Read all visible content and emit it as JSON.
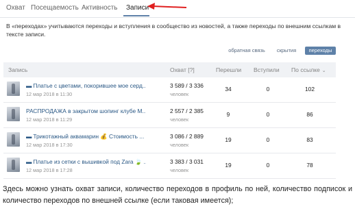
{
  "tabs": [
    {
      "label": "Охват"
    },
    {
      "label": "Посещаемость"
    },
    {
      "label": "Активность"
    },
    {
      "label": "Записи"
    }
  ],
  "info_text": "В «переходах» учитываются переходы и вступления в сообщество из новостей, а также переходы по внешним ссылкам в тексте записи.",
  "filters": [
    {
      "label": "обратная связь"
    },
    {
      "label": "скрытия"
    },
    {
      "label": "переходы"
    }
  ],
  "table": {
    "headers": {
      "post": "Запись",
      "reach": "Охват [?]",
      "clicks": "Перешли",
      "joined": "Вступили",
      "by_link": "По ссылке"
    },
    "rows": [
      {
        "title": "Платье с цветами, покорившее мое серд...",
        "date": "12 мар 2018 в 11:30",
        "reach": "3 589 / 3 336",
        "unit": "человек",
        "clicks": "34",
        "joined": "0",
        "by_link": "102"
      },
      {
        "title": "РАСПРОДАЖА в закрытом шопинг клубе М...",
        "date": "12 мар 2018 в 11:29",
        "reach": "2 557 / 2 385",
        "unit": "человек",
        "clicks": "9",
        "joined": "0",
        "by_link": "86"
      },
      {
        "title": "Трикотажный аквамарин 💰 Стоимость ...",
        "date": "12 мар 2018 в 17:30",
        "reach": "3 086 / 2 889",
        "unit": "человек",
        "clicks": "19",
        "joined": "0",
        "by_link": "83"
      },
      {
        "title": "Платье из сетки с вышивкой под Zara 🍃 ...",
        "date": "12 мар 2018 в 17:28",
        "reach": "3 383 / 3 031",
        "unit": "человек",
        "clicks": "19",
        "joined": "0",
        "by_link": "78"
      }
    ]
  },
  "description": "Здесь можно узнать охват записи, количество переходов в профиль по ней, количество подписок и количество переходов по внешней ссылке (если таковая имеется);",
  "colors": {
    "link": "#2a5885",
    "accent": "#5e81a8",
    "arrow": "#e02020",
    "header_bg": "#f0f2f5"
  }
}
